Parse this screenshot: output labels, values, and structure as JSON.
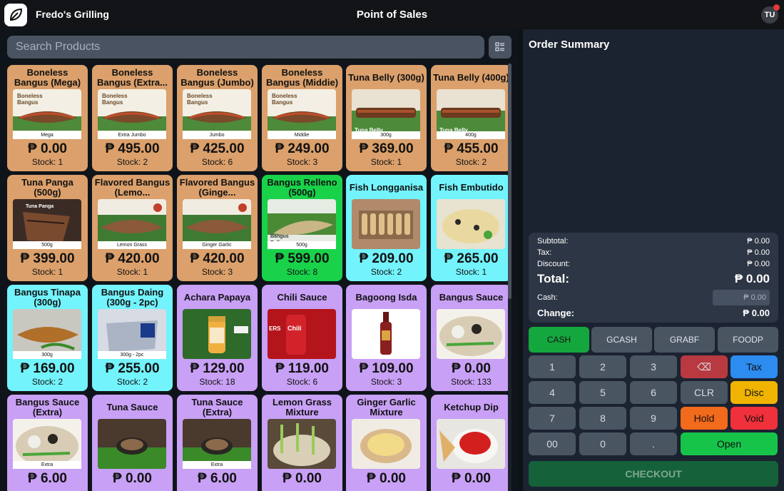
{
  "header": {
    "brand": "Fredo's Grilling",
    "title": "Point of Sales",
    "avatar": "TU",
    "logo_icon": "leaf-icon"
  },
  "search": {
    "placeholder": "Search Products"
  },
  "products": [
    {
      "name": "Boneless Bangus (Mega)",
      "price": "₱ 0.00",
      "stock": "Stock: 1",
      "caption": "Mega",
      "color": "orange",
      "img": "fish"
    },
    {
      "name": "Boneless Bangus (Extra...",
      "price": "₱ 495.00",
      "stock": "Stock: 2",
      "caption": "Extra Jumbo",
      "color": "orange",
      "img": "fish"
    },
    {
      "name": "Boneless Bangus (Jumbo)",
      "price": "₱ 425.00",
      "stock": "Stock: 6",
      "caption": "Jumbo",
      "color": "orange",
      "img": "fish"
    },
    {
      "name": "Boneless Bangus (Middie)",
      "price": "₱ 249.00",
      "stock": "Stock: 3",
      "caption": "Middie",
      "color": "orange",
      "img": "fish"
    },
    {
      "name": "Tuna Belly (300g)",
      "price": "₱ 369.00",
      "stock": "Stock: 1",
      "caption": "300g",
      "color": "orange",
      "img": "belly"
    },
    {
      "name": "Tuna Belly (400g)",
      "price": "₱ 455.00",
      "stock": "Stock: 2",
      "caption": "400g",
      "color": "orange",
      "img": "belly"
    },
    {
      "name": "Tuna Panga (500g)",
      "price": "₱ 399.00",
      "stock": "Stock: 1",
      "caption": "500g",
      "color": "orange",
      "img": "panga"
    },
    {
      "name": "Flavored Bangus (Lemo...",
      "price": "₱ 420.00",
      "stock": "Stock: 1",
      "caption": "Lemon Grass",
      "color": "orange",
      "img": "whole"
    },
    {
      "name": "Flavored Bangus (Ginge...",
      "price": "₱ 420.00",
      "stock": "Stock: 3",
      "caption": "Ginger Garlic",
      "color": "orange",
      "img": "whole"
    },
    {
      "name": "Bangus Relleno (500g)",
      "price": "₱ 599.00",
      "stock": "Stock: 8",
      "caption": "500g",
      "color": "green",
      "img": "relleno"
    },
    {
      "name": "Fish Longganisa",
      "price": "₱ 209.00",
      "stock": "Stock: 2",
      "caption": "",
      "color": "cyan",
      "img": "longganisa"
    },
    {
      "name": "Fish Embutido",
      "price": "₱ 265.00",
      "stock": "Stock: 1",
      "caption": "",
      "color": "cyan",
      "img": "embutido"
    },
    {
      "name": "Bangus Tinapa (300g)",
      "price": "₱ 169.00",
      "stock": "Stock: 2",
      "caption": "300g",
      "color": "cyan",
      "img": "tinapa"
    },
    {
      "name": "Bangus Daing (300g - 2pc)",
      "price": "₱ 255.00",
      "stock": "Stock: 2",
      "caption": "300g - 2pc",
      "color": "cyan",
      "img": "daing"
    },
    {
      "name": "Achara Papaya",
      "price": "₱ 129.00",
      "stock": "Stock: 18",
      "caption": "",
      "color": "purple",
      "img": "jar"
    },
    {
      "name": "Chili Sauce",
      "price": "₱ 119.00",
      "stock": "Stock: 6",
      "caption": "",
      "color": "purple",
      "img": "chili"
    },
    {
      "name": "Bagoong Isda",
      "price": "₱ 109.00",
      "stock": "Stock: 3",
      "caption": "",
      "color": "purple",
      "img": "bottle"
    },
    {
      "name": "Bangus Sauce",
      "price": "₱ 0.00",
      "stock": "Stock: 133",
      "caption": "",
      "color": "purple",
      "img": "platter"
    },
    {
      "name": "Bangus Sauce (Extra)",
      "price": "₱ 6.00",
      "stock": "",
      "caption": "Extra",
      "color": "purple",
      "img": "platter"
    },
    {
      "name": "Tuna Sauce",
      "price": "₱ 0.00",
      "stock": "",
      "caption": "",
      "color": "purple",
      "img": "dip"
    },
    {
      "name": "Tuna Sauce (Extra)",
      "price": "₱ 6.00",
      "stock": "",
      "caption": "Extra",
      "color": "purple",
      "img": "dip"
    },
    {
      "name": "Lemon Grass Mixture",
      "price": "₱ 0.00",
      "stock": "",
      "caption": "",
      "color": "purple",
      "img": "herbs"
    },
    {
      "name": "Ginger Garlic Mixture",
      "price": "₱ 0.00",
      "stock": "",
      "caption": "",
      "color": "purple",
      "img": "ginger"
    },
    {
      "name": "Ketchup Dip",
      "price": "₱ 0.00",
      "stock": "",
      "caption": "",
      "color": "purple",
      "img": "ketchup"
    }
  ],
  "order": {
    "title": "Order Summary",
    "subtotal_label": "Subtotal:",
    "subtotal": "₱ 0.00",
    "tax_label": "Tax:",
    "tax": "₱ 0.00",
    "discount_label": "Discount:",
    "discount": "₱ 0.00",
    "total_label": "Total:",
    "total": "₱ 0.00",
    "cash_label": "Cash:",
    "cash_placeholder": "₱ 0.00",
    "change_label": "Change:",
    "change": "₱ 0.00"
  },
  "payment_methods": [
    "CASH",
    "GCASH",
    "GRABF",
    "FOODP"
  ],
  "keypad": {
    "k1": "1",
    "k2": "2",
    "k3": "3",
    "backspace": "⌫",
    "tax": "Tax",
    "k4": "4",
    "k5": "5",
    "k6": "6",
    "clr": "CLR",
    "disc": "Disc",
    "k7": "7",
    "k8": "8",
    "k9": "9",
    "hold": "Hold",
    "void": "Void",
    "k00": "00",
    "k0": "0",
    "dot": ".",
    "open": "Open"
  },
  "checkout_label": "CHECKOUT",
  "colors": {
    "orange": "#dba06b",
    "green": "#19d24a",
    "cyan": "#73f3fb",
    "purple": "#c8a0f5",
    "red": "#b83a40",
    "blue": "#2d8cf0",
    "yellow": "#f0b400",
    "hold": "#f26a1b",
    "void": "#f0303a",
    "open": "#17c44a"
  }
}
